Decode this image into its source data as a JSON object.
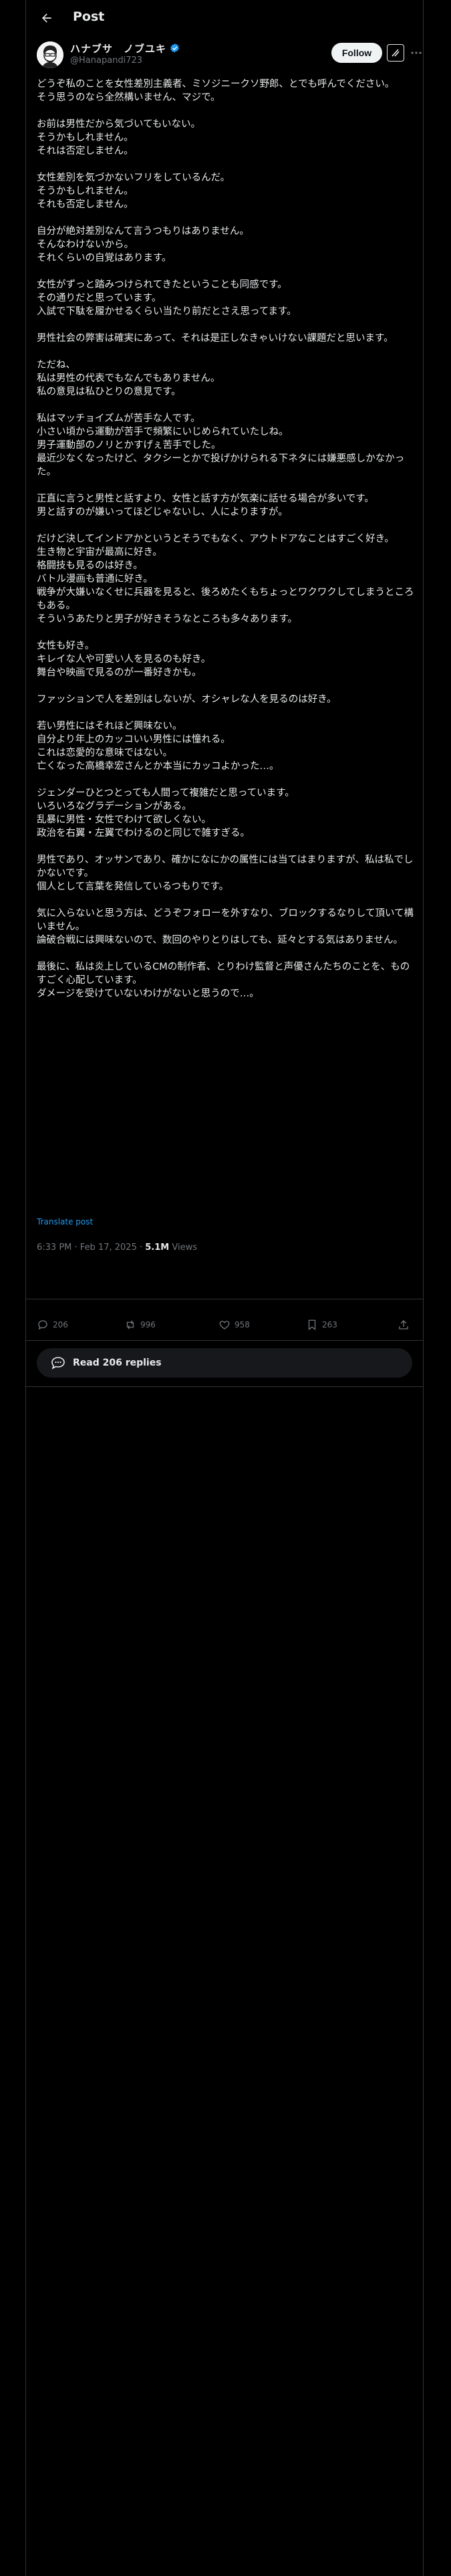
{
  "header": {
    "title": "Post"
  },
  "author": {
    "display_name": "ハナブサ　ノブユキ",
    "handle": "@Hanapandi723",
    "verified": true
  },
  "follow_label": "Follow",
  "post": {
    "text": "どうぞ私のことを女性差別主義者、ミソジニークソ野郎、とでも呼んでください。\nそう思うのなら全然構いません、マジで。\n\nお前は男性だから気づいてもいない。\nそうかもしれません。\nそれは否定しません。\n\n女性差別を気づかないフリをしているんだ。\nそうかもしれません。\nそれも否定しません。\n\n自分が絶対差別なんて言うつもりはありません。\nそんなわけないから。\nそれくらいの自覚はあります。\n\n女性がずっと踏みつけられてきたということも同感です。\nその通りだと思っています。\n入試で下駄を履かせるくらい当たり前だとさえ思ってます。\n\n男性社会の弊害は確実にあって、それは是正しなきゃいけない課題だと思います。\n\nただね、\n私は男性の代表でもなんでもありません。\n私の意見は私ひとりの意見です。\n\n私はマッチョイズムが苦手な人です。\n小さい頃から運動が苦手で頻繁にいじめられていたしね。\n男子運動部のノリとかすげぇ苦手でした。\n最近少なくなったけど、タクシーとかで投げかけられる下ネタには嫌悪感しかなかった。\n\n正直に言うと男性と話すより、女性と話す方が気楽に話せる場合が多いです。\n男と話すのが嫌いってほどじゃないし、人によりますが。\n\nだけど決してインドアかというとそうでもなく、アウトドアなことはすごく好き。\n生き物と宇宙が最高に好き。\n格闘技も見るのは好き。\nバトル漫画も普通に好き。\n戦争が大嫌いなくせに兵器を見ると、後ろめたくもちょっとワクワクしてしまうところもある。\nそういうあたりと男子が好きそうなところも多々あります。\n\n女性も好き。\nキレイな人や可愛い人を見るのも好き。\n舞台や映画で見るのが一番好きかも。\n\nファッションで人を差別はしないが、オシャレな人を見るのは好き。\n\n若い男性にはそれほど興味ない。\n自分より年上のカッコいい男性には憧れる。\nこれは恋愛的な意味ではない。\n亡くなった高橋幸宏さんとか本当にカッコよかった…。\n\nジェンダーひとつとっても人間って複雑だと思っています。\nいろいろなグラデーションがある。\n乱暴に男性・女性でわけて欲しくない。\n政治を右翼・左翼でわけるのと同じで雑すぎる。\n\n男性であり、オッサンであり、確かになにかの属性には当てはまりますが、私は私でしかないです。\n個人として言葉を発信しているつもりです。\n\n気に入らないと思う方は、どうぞフォローを外すなり、ブロックするなりして頂いて構いません。\n論破合戦には興味ないので、数回のやりとりはしても、延々とする気はありません。\n\n最後に、私は炎上しているCMの制作者、とりわけ監督と声優さんたちのことを、ものすごく心配しています。\nダメージを受けていないわけがないと思うので…。",
    "translate_label": "Translate post",
    "time": "6:33 PM",
    "date": "Feb 17, 2025",
    "views_count": "5.1M",
    "views_label": "Views"
  },
  "actions": {
    "replies": "206",
    "reposts": "996",
    "likes": "958",
    "bookmarks": "263"
  },
  "read_replies_label": "Read 206 replies",
  "colors": {
    "background": "#000000",
    "text": "#e7e9ea",
    "muted": "#71767b",
    "accent": "#1d9bf0",
    "border": "#2f3336"
  }
}
